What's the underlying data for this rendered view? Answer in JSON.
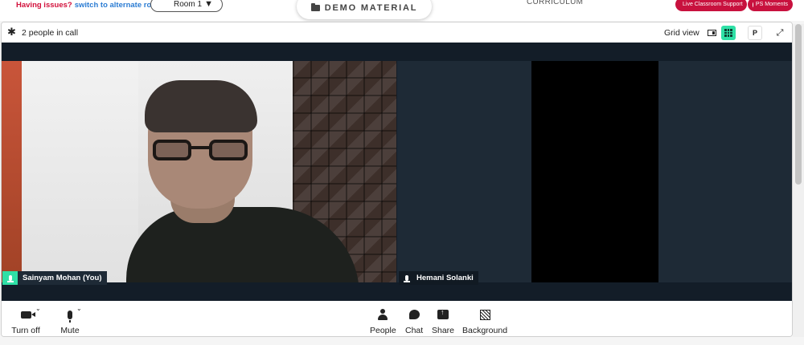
{
  "topbar": {
    "issues_text": "Having issues?",
    "alternate_link": "switch to alternate room",
    "room_select": "Room 1",
    "demo_material": "DEMO MATERIAL",
    "curriculum": "CURRICULUM",
    "live_support": "Live Classroom Support",
    "ps_moments": "PS Moments"
  },
  "call": {
    "people_count": "2 people in call",
    "view_label": "Grid view",
    "pin_label": "P"
  },
  "participants": {
    "me": "Sainyam Mohan (You)",
    "other": "Hemani Solanki"
  },
  "toolbar": {
    "camera": "Turn off",
    "mic": "Mute",
    "people": "People",
    "chat": "Chat",
    "share": "Share",
    "background": "Background"
  },
  "colors": {
    "accent": "#2fe0a6",
    "brand_red": "#c8113e",
    "stage": "#1e2a36"
  }
}
